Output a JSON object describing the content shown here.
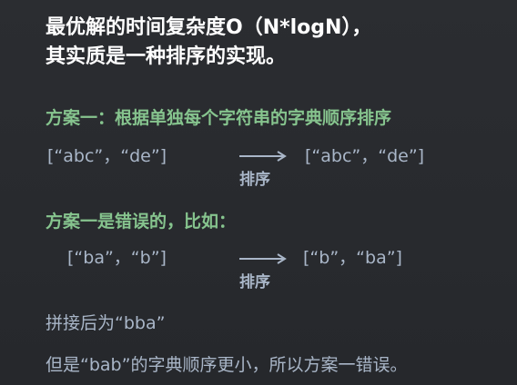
{
  "title": {
    "line1": "最优解的时间复杂度O（N*logN），",
    "line2": "其实质是一种排序的实现。"
  },
  "plan1": {
    "heading": "方案一：根据单独每个字符串的字典顺序排序",
    "before": "[“abc”，“de”]",
    "after": "[“abc”，“de”]",
    "sort_label": "排序"
  },
  "plan1_wrong": {
    "heading": "方案一是错误的，比如：",
    "before": "[“ba”，“b”]",
    "after": "[“b”，“ba”]",
    "sort_label": "排序"
  },
  "conclusion": {
    "line1": "拼接后为“bba”",
    "line2": "但是“bab”的字典顺序更小，所以方案一错误。"
  },
  "colors": {
    "background": "#2a2c30",
    "title_text": "#ffffff",
    "heading_green": "#86c48e",
    "body_gray": "#a9b6c8"
  }
}
